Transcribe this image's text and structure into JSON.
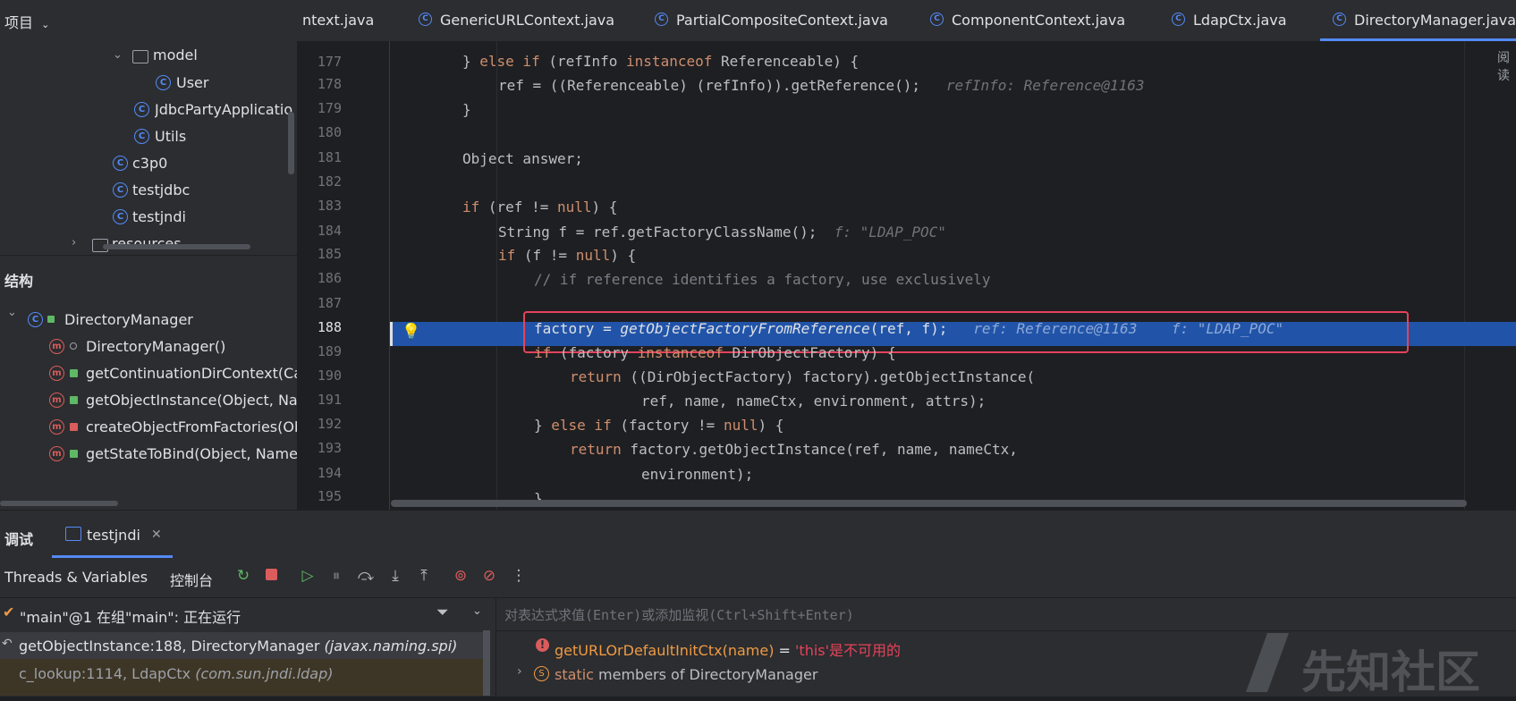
{
  "project": {
    "title": "项目",
    "tree": [
      {
        "label": "model",
        "kind": "folder"
      },
      {
        "label": "User",
        "kind": "class"
      },
      {
        "label": "JdbcPartyApplication",
        "kind": "class"
      },
      {
        "label": "Utils",
        "kind": "class"
      },
      {
        "label": "c3p0",
        "kind": "class"
      },
      {
        "label": "testjdbc",
        "kind": "class"
      },
      {
        "label": "testjndi",
        "kind": "class"
      },
      {
        "label": "resources",
        "kind": "folder"
      }
    ]
  },
  "structure": {
    "title": "结构",
    "root": "DirectoryManager",
    "members": [
      "DirectoryManager()",
      "getContinuationDirContext(Ca",
      "getObjectInstance(Object, Nam",
      "createObjectFromFactories(Ob",
      "getStateToBind(Object, Name,"
    ]
  },
  "tabs": [
    "ntext.java",
    "GenericURLContext.java",
    "PartialCompositeContext.java",
    "ComponentContext.java",
    "LdapCtx.java",
    "DirectoryManager.java"
  ],
  "reader_mode": "阅读",
  "editor": {
    "line_numbers": [
      "177",
      "178",
      "179",
      "180",
      "181",
      "182",
      "183",
      "184",
      "185",
      "186",
      "187",
      "188",
      "189",
      "190",
      "191",
      "192",
      "193",
      "194",
      "195"
    ],
    "lines": {
      "l177a": "} ",
      "l177b": "else if",
      "l177c": " (refInfo ",
      "l177d": "instanceof",
      "l177e": " Referenceable) {",
      "l178a": "ref = ((Referenceable) (refInfo)).getReference();",
      "l178h": "refInfo: Reference@1163",
      "l179": "}",
      "l181": "Object answer;",
      "l183a": "if",
      "l183b": " (ref != ",
      "l183c": "null",
      "l183d": ") {",
      "l184a": "String f = ref.getFactoryClassName();",
      "l184h": "f: \"LDAP_POC\"",
      "l185a": "if",
      "l185b": " (f != ",
      "l185c": "null",
      "l185d": ") {",
      "l186": "// if reference identifies a factory, use exclusively",
      "l188a": "factory = ",
      "l188b": "getObjectFactoryFromReference",
      "l188c": "(ref, f);",
      "l188h1": "ref: Reference@1163",
      "l188h2": "f: \"LDAP_POC\"",
      "l189a": "if",
      "l189b": " (factory ",
      "l189c": "instanceof",
      "l189d": " DirObjectFactory) {",
      "l190a": "return",
      "l190b": " ((DirObjectFactory) factory).getObjectInstance(",
      "l191": "ref, name, nameCtx, environment, attrs);",
      "l192a": "} ",
      "l192b": "else if",
      "l192c": " (factory != ",
      "l192d": "null",
      "l192e": ") {",
      "l193a": "return",
      "l193b": " factory.getObjectInstance(ref, name, nameCtx,",
      "l194": "environment);",
      "l195": "}"
    }
  },
  "debug": {
    "title": "调试",
    "session_tab": "testjndi",
    "tab_threads": "Threads & Variables",
    "tab_console": "控制台",
    "thread_status": "\"main\"@1 在组\"main\": 正在运行",
    "eval_placeholder": "对表达式求值(Enter)或添加监视(Ctrl+Shift+Enter)",
    "frames": [
      {
        "method": "getObjectInstance:188, DirectoryManager",
        "pkg": "(javax.naming.spi)"
      },
      {
        "method": "c_lookup:1114, LdapCtx",
        "pkg": "(com.sun.jndi.ldap)"
      }
    ],
    "variables": [
      {
        "name": "getURLOrDefaultInitCtx(name)",
        "eq": " = ",
        "value": "'this'是不可用的"
      },
      {
        "name": "static",
        "rest": " members of DirectoryManager"
      }
    ]
  },
  "watermark": "先知社区",
  "colors": {
    "accent": "#548af7",
    "highlight": "#2154a8",
    "keyword": "#cf8e6d",
    "error_box": "#e5435a"
  }
}
